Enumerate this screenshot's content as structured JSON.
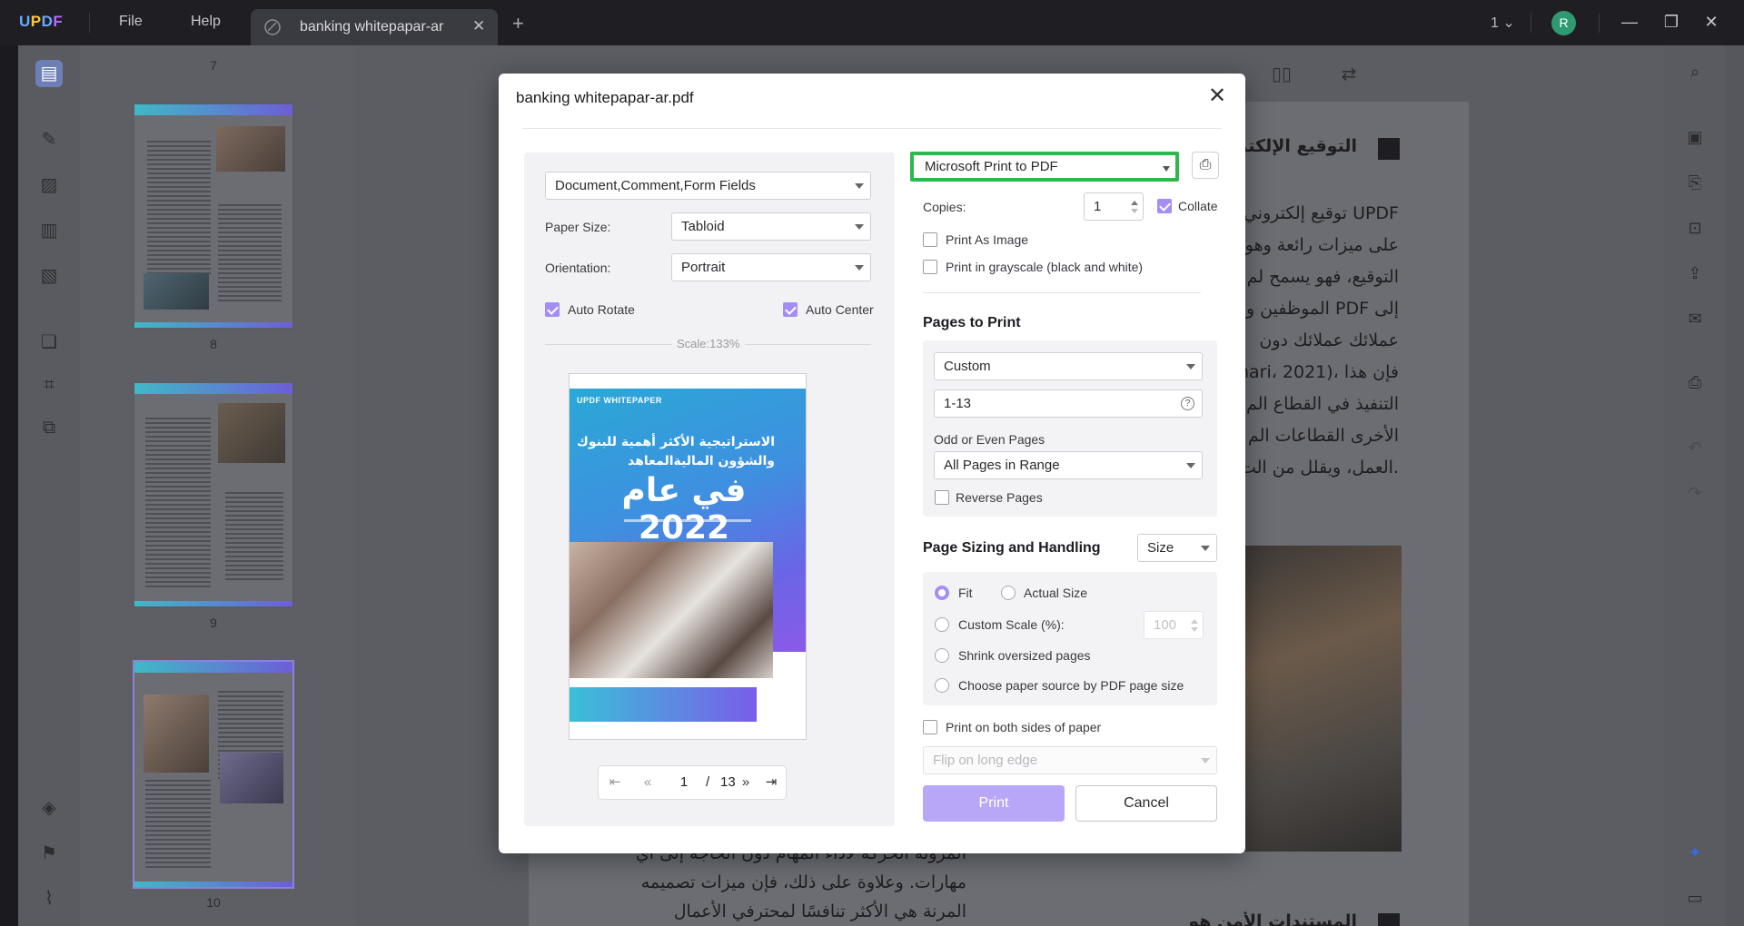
{
  "app": {
    "logo": "UPDF",
    "menu": [
      "File",
      "Help"
    ],
    "tab_title": "banking whitepapar-ar",
    "page_indicator": "1",
    "avatar_initial": "R",
    "accent_color": "#a48ef6"
  },
  "thumbnails": {
    "labels": [
      "7",
      "8",
      "9",
      "10"
    ]
  },
  "document": {
    "heading_top": "التوقيع الإلكترو",
    "body_lines": [
      "UPDF توقيع إلكتروني",
      "على ميزات رائعة وهو",
      "التوقيع، فهو يسمح لم",
      "إلى PDF الموظفين وا",
      "عملائك عملائك دون",
      "فإن هذا ،(mari، 2021",
      "التنفيذ في القطاع الم",
      "الأخرى القطاعات الم",
      ".العمل، ويقلل من الت"
    ],
    "bottom_lines": [
      "المرونة الحركة لأداء المهام دون الحاجة إلى أي",
      "مهارات. وعلاوة على ذلك، فإن ميزات تصميمه",
      "المرنة هي الأكثر تنافسًا لمحترفي الأعمال"
    ],
    "heading_bottom": "المستندات الأمن هو"
  },
  "dialog": {
    "title": "banking whitepapar-ar.pdf",
    "content_select": "Document,Comment,Form Fields",
    "paper_size_label": "Paper Size:",
    "paper_size_value": "Tabloid",
    "orientation_label": "Orientation:",
    "orientation_value": "Portrait",
    "auto_rotate_label": "Auto Rotate",
    "auto_center_label": "Auto Center",
    "scale_label": "Scale:133%",
    "preview": {
      "tag": "UPDF WHITEPAPER",
      "title_line1": "الاستراتيجية الأكثر أهمية للبنوك",
      "title_line2": "والشؤون الماليةالمعاهد",
      "big_title": "في عام 2022"
    },
    "pager": {
      "current": "1",
      "separator": "/",
      "total": "13"
    },
    "printer": "Microsoft Print to PDF",
    "copies_label": "Copies:",
    "copies_value": "1",
    "collate_label": "Collate",
    "print_as_image_label": "Print As Image",
    "grayscale_label": "Print in grayscale (black and white)",
    "pages_section": "Pages to Print",
    "pages_mode": "Custom",
    "pages_range": "1-13",
    "odd_even_label": "Odd or Even Pages",
    "odd_even_value": "All Pages in Range",
    "reverse_label": "Reverse Pages",
    "sizing_section": "Page Sizing and Handling",
    "sizing_mode": "Size",
    "fit_label": "Fit",
    "actual_size_label": "Actual Size",
    "custom_scale_label": "Custom Scale (%):",
    "custom_scale_value": "100",
    "shrink_label": "Shrink oversized pages",
    "paper_source_label": "Choose paper source by PDF page size",
    "both_sides_label": "Print on both sides of paper",
    "flip_value": "Flip on long edge",
    "print_button": "Print",
    "cancel_button": "Cancel"
  }
}
